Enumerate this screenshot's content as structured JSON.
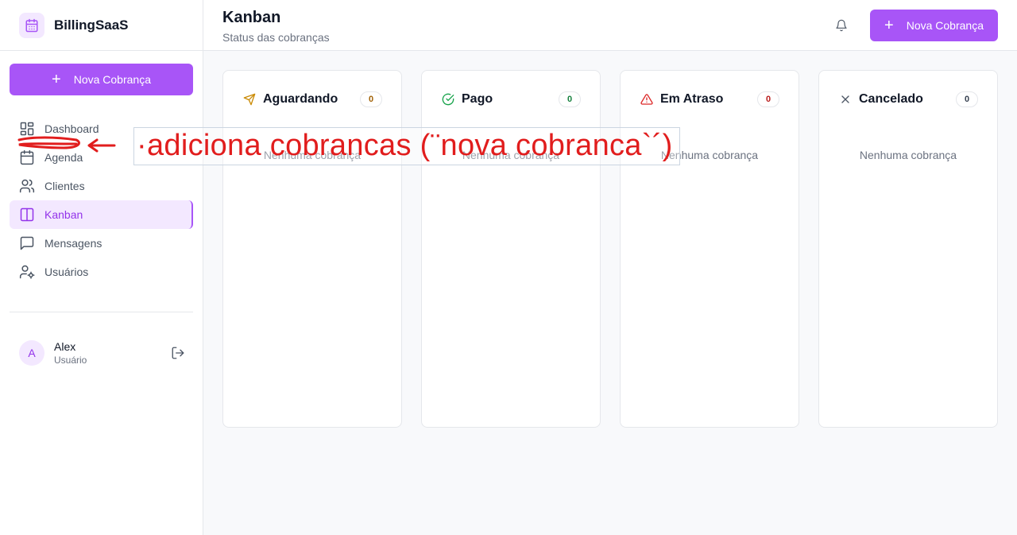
{
  "sidebar": {
    "brand": "BillingSaaS",
    "brand_icon": "calendar-icon",
    "cta_label": "Nova Cobrança",
    "items": [
      {
        "label": "Dashboard",
        "icon": "dashboard-grid-icon"
      },
      {
        "label": "Agenda",
        "icon": "calendar-icon"
      },
      {
        "label": "Clientes",
        "icon": "users-icon"
      },
      {
        "label": "Kanban",
        "icon": "columns-icon",
        "active": true
      },
      {
        "label": "Mensagens",
        "icon": "message-icon"
      },
      {
        "label": "Usuários",
        "icon": "user-settings-icon"
      }
    ],
    "user": {
      "initial": "A",
      "name": "Alex",
      "role": "Usuário",
      "logout_icon": "logout-icon"
    }
  },
  "header": {
    "title": "Kanban",
    "subtitle": "Status das cobranças",
    "bell_icon": "bell-icon",
    "cta_label": "Nova Cobrança"
  },
  "board": {
    "columns": [
      {
        "title": "Aguardando",
        "count": "0",
        "empty": "Nenhuma cobrança",
        "icon": "send-icon",
        "color": "#ca8a04"
      },
      {
        "title": "Pago",
        "count": "0",
        "empty": "Nenhuma cobrança",
        "icon": "check-circle-icon",
        "color": "#16a34a"
      },
      {
        "title": "Em Atraso",
        "count": "0",
        "empty": "Nenhuma cobrança",
        "icon": "alert-triangle-icon",
        "color": "#dc2626"
      },
      {
        "title": "Cancelado",
        "count": "0",
        "empty": "Nenhuma cobrança",
        "icon": "x-icon",
        "color": "#4b5563"
      }
    ]
  },
  "annotation": {
    "text": "·adiciona cobrancas (¨nova cobranca`´)",
    "color": "#e11d1d"
  },
  "colors": {
    "accent": "#a855f7",
    "accent_light": "#f3e8ff",
    "border": "#e5e7eb",
    "background": "#f8f9fb"
  }
}
